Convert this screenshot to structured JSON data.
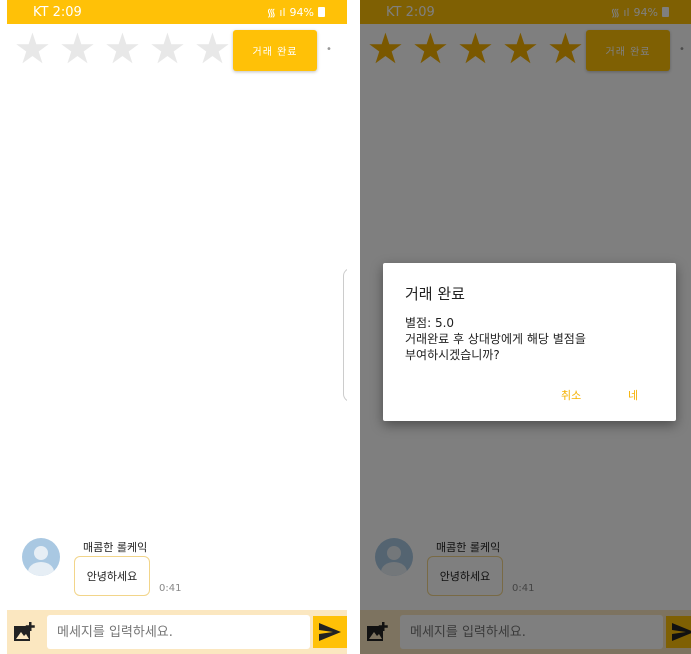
{
  "status_bar": {
    "carrier_time": "KT 2:09",
    "right_text": "94%"
  },
  "rating": {
    "left_value": 0,
    "right_value": 5,
    "max": 5
  },
  "complete_button": {
    "label": "거래 완료"
  },
  "chat": {
    "sender_name": "매콤한 롤케익",
    "message": "안녕하세요",
    "time": "0:41"
  },
  "input": {
    "placeholder": "메세지를 입력하세요."
  },
  "dialog": {
    "title": "거래 완료",
    "message": "별점: 5.0\n거래완료 후 상대방에게 해당 별점을\n부여하시겠습니까?",
    "cancel_label": "취소",
    "ok_label": "네"
  },
  "colors": {
    "accent": "#ffc107",
    "star_filled": "#f5b100",
    "star_empty": "#e8e8e8"
  }
}
